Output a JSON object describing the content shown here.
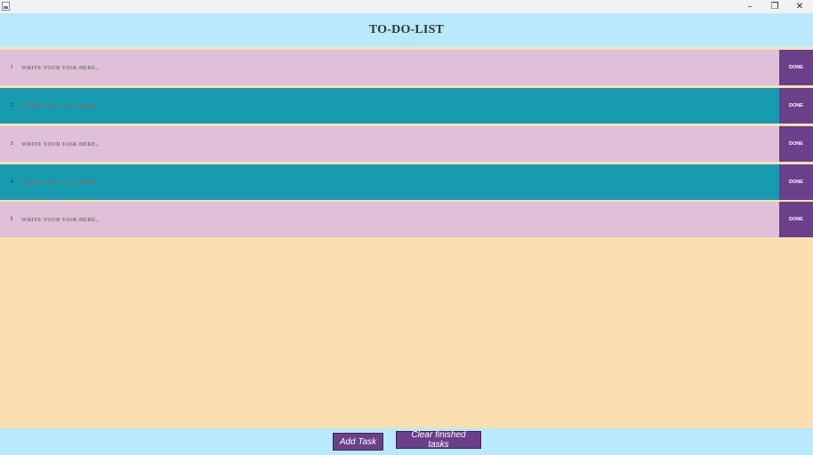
{
  "window": {
    "controls": {
      "minimize": "–",
      "maximize": "❐",
      "close": "✕"
    },
    "icon": "java-app-icon"
  },
  "header": {
    "title": "TO-DO-LIST"
  },
  "tasks": [
    {
      "number": "1",
      "placeholder": "WRITE YOUR TASK HERE..",
      "value": "",
      "done_label": "DONE"
    },
    {
      "number": "2",
      "placeholder": "WRITE YOUR TASK HERE..",
      "value": "",
      "done_label": "DONE"
    },
    {
      "number": "3",
      "placeholder": "WRITE YOUR TASK HERE..",
      "value": "",
      "done_label": "DONE"
    },
    {
      "number": "4",
      "placeholder": "WRITE YOUR TASK HERE..",
      "value": "",
      "done_label": "DONE"
    },
    {
      "number": "5",
      "placeholder": "WRITE YOUR TASK HERE..",
      "value": "",
      "done_label": "DONE"
    }
  ],
  "footer": {
    "add_label": "Add Task",
    "clear_label": "Clear finished tasks"
  },
  "colors": {
    "header_bg": "#b8e9fd",
    "row_pink": "#e0bfd8",
    "row_teal": "#179bb0",
    "button_purple": "#6b3f8a",
    "body_bg": "#fbdfb1"
  }
}
